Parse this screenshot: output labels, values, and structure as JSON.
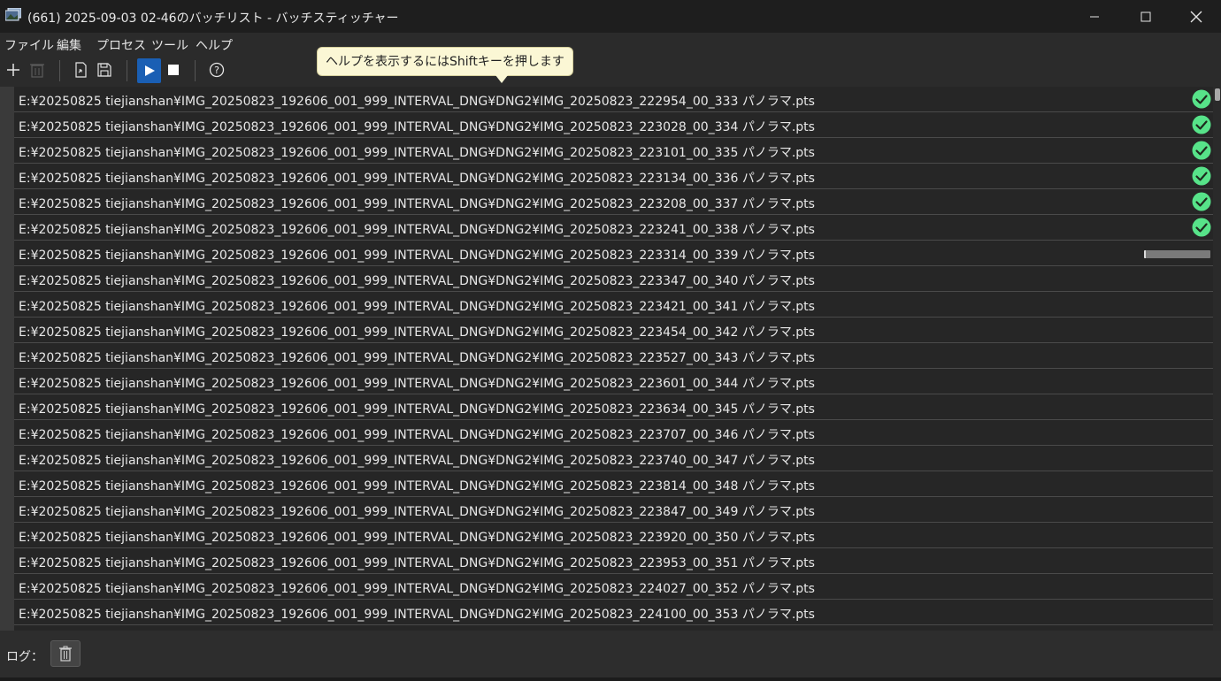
{
  "window": {
    "title": "(661) 2025-09-03 02-46のバッチリスト - バッチスティッチャー"
  },
  "menu": {
    "items": [
      "ファイル",
      "編集",
      "プロセス",
      "ツール",
      "ヘルプ"
    ]
  },
  "toolbar": {
    "buttons": [
      {
        "name": "add-icon"
      },
      {
        "name": "delete-icon",
        "disabled": true
      },
      {
        "name": "open-file-icon"
      },
      {
        "name": "save-icon"
      },
      {
        "name": "play-icon",
        "active": true
      },
      {
        "name": "stop-icon"
      },
      {
        "name": "help-icon"
      }
    ]
  },
  "tooltip": {
    "text": "ヘルプを表示するにはShiftキーを押します"
  },
  "colors": {
    "accent": "#1a5fb4",
    "ok": "#57e389",
    "background": "#262626"
  },
  "list": {
    "rows": [
      {
        "path": "E:¥20250825  tiejianshan¥IMG_20250823_192606_001_999_INTERVAL_DNG¥DNG2¥IMG_20250823_222954_00_333 パノラマ.pts",
        "status": "done"
      },
      {
        "path": "E:¥20250825  tiejianshan¥IMG_20250823_192606_001_999_INTERVAL_DNG¥DNG2¥IMG_20250823_223028_00_334 パノラマ.pts",
        "status": "done"
      },
      {
        "path": "E:¥20250825  tiejianshan¥IMG_20250823_192606_001_999_INTERVAL_DNG¥DNG2¥IMG_20250823_223101_00_335 パノラマ.pts",
        "status": "done"
      },
      {
        "path": "E:¥20250825  tiejianshan¥IMG_20250823_192606_001_999_INTERVAL_DNG¥DNG2¥IMG_20250823_223134_00_336 パノラマ.pts",
        "status": "done"
      },
      {
        "path": "E:¥20250825  tiejianshan¥IMG_20250823_192606_001_999_INTERVAL_DNG¥DNG2¥IMG_20250823_223208_00_337 パノラマ.pts",
        "status": "done"
      },
      {
        "path": "E:¥20250825  tiejianshan¥IMG_20250823_192606_001_999_INTERVAL_DNG¥DNG2¥IMG_20250823_223241_00_338 パノラマ.pts",
        "status": "done"
      },
      {
        "path": "E:¥20250825  tiejianshan¥IMG_20250823_192606_001_999_INTERVAL_DNG¥DNG2¥IMG_20250823_223314_00_339 パノラマ.pts",
        "status": "running",
        "progress": 0.03
      },
      {
        "path": "E:¥20250825  tiejianshan¥IMG_20250823_192606_001_999_INTERVAL_DNG¥DNG2¥IMG_20250823_223347_00_340 パノラマ.pts",
        "status": "pending"
      },
      {
        "path": "E:¥20250825  tiejianshan¥IMG_20250823_192606_001_999_INTERVAL_DNG¥DNG2¥IMG_20250823_223421_00_341 パノラマ.pts",
        "status": "pending"
      },
      {
        "path": "E:¥20250825  tiejianshan¥IMG_20250823_192606_001_999_INTERVAL_DNG¥DNG2¥IMG_20250823_223454_00_342 パノラマ.pts",
        "status": "pending"
      },
      {
        "path": "E:¥20250825  tiejianshan¥IMG_20250823_192606_001_999_INTERVAL_DNG¥DNG2¥IMG_20250823_223527_00_343 パノラマ.pts",
        "status": "pending"
      },
      {
        "path": "E:¥20250825  tiejianshan¥IMG_20250823_192606_001_999_INTERVAL_DNG¥DNG2¥IMG_20250823_223601_00_344 パノラマ.pts",
        "status": "pending"
      },
      {
        "path": "E:¥20250825  tiejianshan¥IMG_20250823_192606_001_999_INTERVAL_DNG¥DNG2¥IMG_20250823_223634_00_345 パノラマ.pts",
        "status": "pending"
      },
      {
        "path": "E:¥20250825  tiejianshan¥IMG_20250823_192606_001_999_INTERVAL_DNG¥DNG2¥IMG_20250823_223707_00_346 パノラマ.pts",
        "status": "pending"
      },
      {
        "path": "E:¥20250825  tiejianshan¥IMG_20250823_192606_001_999_INTERVAL_DNG¥DNG2¥IMG_20250823_223740_00_347 パノラマ.pts",
        "status": "pending"
      },
      {
        "path": "E:¥20250825  tiejianshan¥IMG_20250823_192606_001_999_INTERVAL_DNG¥DNG2¥IMG_20250823_223814_00_348 パノラマ.pts",
        "status": "pending"
      },
      {
        "path": "E:¥20250825  tiejianshan¥IMG_20250823_192606_001_999_INTERVAL_DNG¥DNG2¥IMG_20250823_223847_00_349 パノラマ.pts",
        "status": "pending"
      },
      {
        "path": "E:¥20250825  tiejianshan¥IMG_20250823_192606_001_999_INTERVAL_DNG¥DNG2¥IMG_20250823_223920_00_350 パノラマ.pts",
        "status": "pending"
      },
      {
        "path": "E:¥20250825  tiejianshan¥IMG_20250823_192606_001_999_INTERVAL_DNG¥DNG2¥IMG_20250823_223953_00_351 パノラマ.pts",
        "status": "pending"
      },
      {
        "path": "E:¥20250825  tiejianshan¥IMG_20250823_192606_001_999_INTERVAL_DNG¥DNG2¥IMG_20250823_224027_00_352 パノラマ.pts",
        "status": "pending"
      },
      {
        "path": "E:¥20250825  tiejianshan¥IMG_20250823_192606_001_999_INTERVAL_DNG¥DNG2¥IMG_20250823_224100_00_353 パノラマ.pts",
        "status": "pending"
      }
    ]
  },
  "log": {
    "label": "ログ："
  }
}
